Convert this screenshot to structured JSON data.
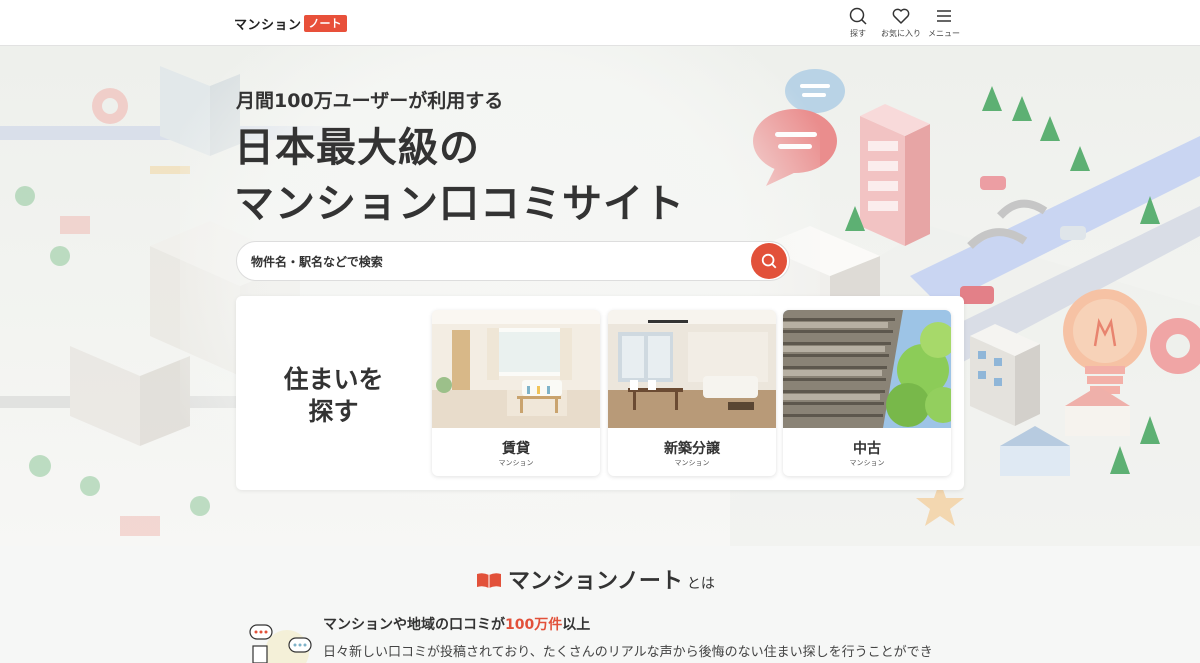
{
  "header": {
    "logo_text": "マンション",
    "logo_badge": "ノート",
    "nav": [
      {
        "label": "探す",
        "icon": "search-icon"
      },
      {
        "label": "お気に入り",
        "icon": "heart-icon"
      },
      {
        "label": "メニュー",
        "icon": "hamburger-icon"
      }
    ]
  },
  "hero": {
    "subtitle": "月間100万ユーザーが利用する",
    "title_line1": "日本最大級の",
    "title_line2": "マンション口コミサイト",
    "search_placeholder": "物件名・駅名などで検索"
  },
  "find": {
    "label_line1": "住まいを",
    "label_line2": "探す",
    "types": [
      {
        "name": "賃貸",
        "sub": "マンション"
      },
      {
        "name": "新築分譲",
        "sub": "マンション"
      },
      {
        "name": "中古",
        "sub": "マンション"
      }
    ]
  },
  "about": {
    "brand": "マンションノート",
    "suffix": "とは",
    "feature_title_prefix": "マンションや地域の口コミが",
    "feature_title_highlight": "100万件",
    "feature_title_suffix": "以上",
    "feature_desc": "日々新しい口コミが投稿されており、たくさんのリアルな声から後悔のない住まい探しを行うことができ"
  },
  "colors": {
    "accent": "#e2513a",
    "text": "#333333"
  }
}
